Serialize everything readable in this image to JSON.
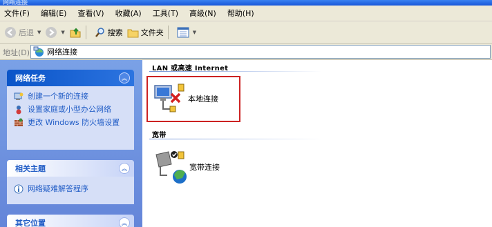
{
  "window": {
    "title": "网络连接"
  },
  "menu": [
    "文件(F)",
    "编辑(E)",
    "查看(V)",
    "收藏(A)",
    "工具(T)",
    "高级(N)",
    "帮助(H)"
  ],
  "toolbar": {
    "back_label": "后退",
    "search_label": "搜索",
    "folders_label": "文件夹"
  },
  "address": {
    "label": "地址(D)",
    "value": "网络连接"
  },
  "sidebar": {
    "network_tasks": {
      "title": "网络任务",
      "items": [
        {
          "label": "创建一个新的连接",
          "icon": "new-connection-icon"
        },
        {
          "label": "设置家庭或小型办公网络",
          "icon": "home-network-icon"
        },
        {
          "label": "更改 Windows 防火墙设置",
          "icon": "firewall-icon"
        }
      ]
    },
    "related_topics": {
      "title": "相关主题",
      "items": [
        {
          "label": "网络疑难解答程序",
          "icon": "info-icon"
        }
      ]
    },
    "other_places": {
      "title": "其它位置"
    }
  },
  "content": {
    "groups": [
      {
        "title": "LAN 或高速 Internet",
        "items": [
          {
            "label": "本地连接",
            "status": "disconnected"
          }
        ]
      },
      {
        "title": "宽带",
        "items": [
          {
            "label": "宽带连接"
          }
        ]
      }
    ]
  },
  "colors": {
    "accent": "#215dc6",
    "highlight_box": "#cc2222",
    "xp_blue": "#0a54c8"
  }
}
